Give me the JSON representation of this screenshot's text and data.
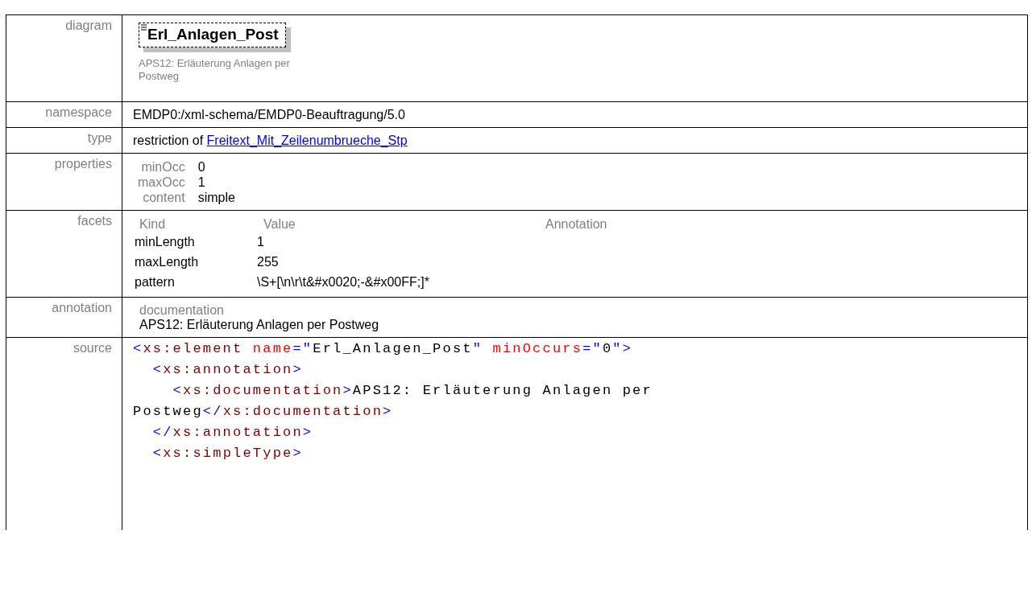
{
  "diagram": {
    "element_name": "Erl_Anlagen_Post",
    "description": "APS12: Erläuterung Anlagen per Postweg"
  },
  "namespace": {
    "label": "namespace",
    "value": "EMDP0:/xml-schema/EMDP0-Beauftragung/5.0"
  },
  "type": {
    "label": "type",
    "prefix": "restriction of",
    "link": "Freitext_Mit_Zeilenumbrueche_Stp"
  },
  "properties": {
    "label": "properties",
    "items": [
      {
        "name": "minOcc",
        "value": "0"
      },
      {
        "name": "maxOcc",
        "value": "1"
      },
      {
        "name": "content",
        "value": "simple"
      }
    ]
  },
  "facets": {
    "label": "facets",
    "columns": [
      "Kind",
      "Value",
      "Annotation"
    ],
    "rows": [
      {
        "kind": "minLength",
        "value": "1"
      },
      {
        "kind": "maxLength",
        "value": "255"
      },
      {
        "kind": "pattern",
        "value": "\\S+[\\n\\r\\t&#x0020;-&#x00FF;]*"
      }
    ]
  },
  "annotation": {
    "label": "annotation",
    "heading": "documentation",
    "text": "APS12: Erläuterung Anlagen per Postweg"
  },
  "diagram_label": "diagram",
  "source": {
    "label": "source",
    "lines": [
      [
        {
          "kind": "bracket",
          "text": "<"
        },
        {
          "kind": "tag",
          "text": "xs:element"
        },
        {
          "kind": "attr",
          "text": " name"
        },
        {
          "kind": "bracket",
          "text": "=\""
        },
        {
          "kind": "text",
          "text": "Erl_Anlagen_Post"
        },
        {
          "kind": "bracket",
          "text": "\""
        },
        {
          "kind": "attr",
          "text": " minOccurs"
        },
        {
          "kind": "bracket",
          "text": "=\""
        },
        {
          "kind": "text",
          "text": "0"
        },
        {
          "kind": "bracket",
          "text": "\">"
        }
      ],
      [
        {
          "kind": "bracket",
          "text": "  <"
        },
        {
          "kind": "tag",
          "text": "xs:annotation"
        },
        {
          "kind": "bracket",
          "text": ">"
        }
      ],
      [
        {
          "kind": "bracket",
          "text": "    <"
        },
        {
          "kind": "tag",
          "text": "xs:documentation"
        },
        {
          "kind": "bracket",
          "text": ">"
        },
        {
          "kind": "text",
          "text": "APS12: Erläuterung Anlagen per"
        }
      ],
      [
        {
          "kind": "text",
          "text": "Postweg"
        },
        {
          "kind": "bracket",
          "text": "</"
        },
        {
          "kind": "tag",
          "text": "xs:documentation"
        },
        {
          "kind": "bracket",
          "text": ">"
        }
      ],
      [
        {
          "kind": "bracket",
          "text": "  </"
        },
        {
          "kind": "tag",
          "text": "xs:annotation"
        },
        {
          "kind": "bracket",
          "text": ">"
        }
      ],
      [
        {
          "kind": "bracket",
          "text": "  <"
        },
        {
          "kind": "tag",
          "text": "xs:simpleType"
        },
        {
          "kind": "bracket",
          "text": ">"
        }
      ]
    ]
  }
}
